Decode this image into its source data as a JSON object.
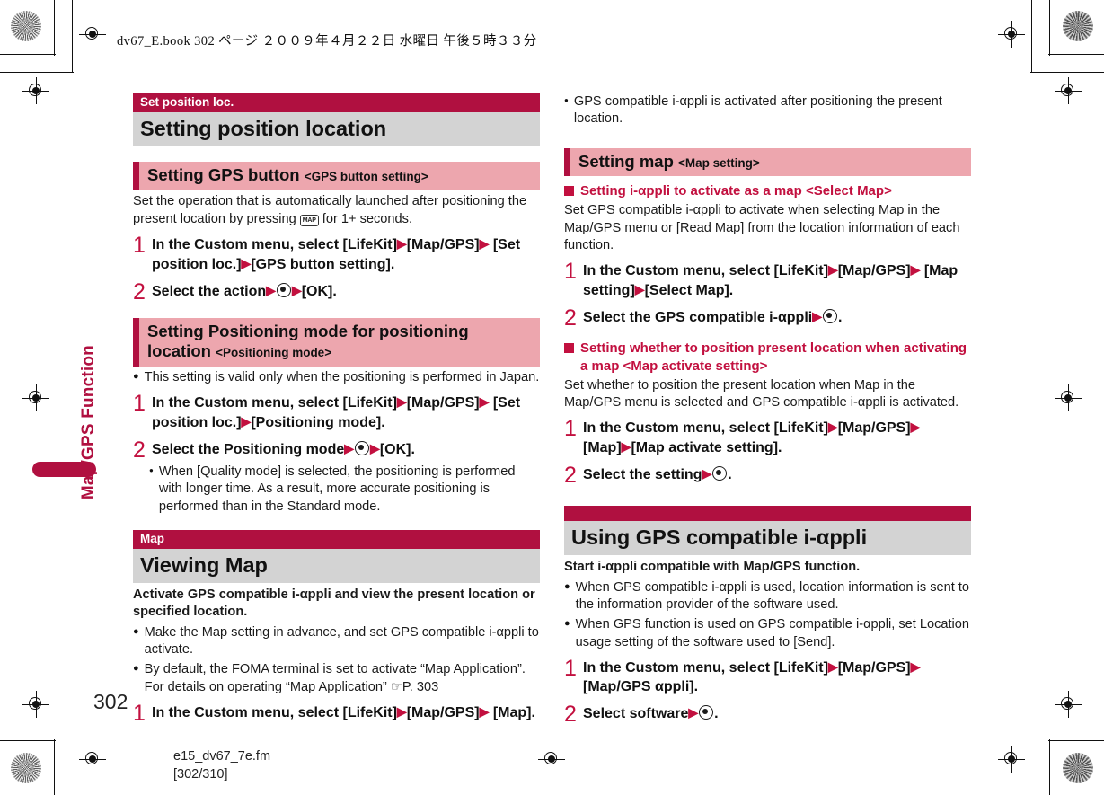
{
  "print_slug": "dv67_E.book   302 ページ   ２００９年４月２２日   水曜日   午後５時３３分",
  "thumb_tab": {
    "label": "Map/GPS Function"
  },
  "footer": {
    "page_number": "302",
    "filename": "e15_dv67_7e.fm",
    "page_range": "[302/310]"
  },
  "colors": {
    "crimson": "#B01040",
    "accent_red": "#C2103F",
    "pink_band": "#EDA6AE",
    "gray_band": "#D3D3D3"
  },
  "left_column": {
    "section": {
      "eyebrow": "Set position loc.",
      "title": "Setting position location"
    },
    "sub_gps_button": {
      "title": "Setting GPS button",
      "angle": "<GPS button setting>",
      "intro_a": "Set the operation that is automatically launched after positioning the present location by pressing ",
      "intro_key": "MAP",
      "intro_b": " for 1+ seconds.",
      "steps": [
        {
          "num": "1",
          "parts": [
            "In the Custom menu, select [LifeKit]",
            "[Map/GPS]",
            "[Set position loc.]",
            "[GPS button setting]."
          ]
        },
        {
          "num": "2",
          "lead": "Select the action",
          "tail": "[OK]."
        }
      ]
    },
    "sub_positioning_mode": {
      "title": "Setting Positioning mode for positioning location",
      "angle": "<Positioning mode>",
      "note": "This setting is valid only when the positioning is performed in Japan.",
      "steps": [
        {
          "num": "1",
          "parts": [
            "In the Custom menu, select [LifeKit]",
            "[Map/GPS]",
            "[Set position loc.]",
            "[Positioning mode]."
          ]
        },
        {
          "num": "2",
          "lead": "Select the Positioning mode",
          "tail": "[OK].",
          "subnote": "When [Quality mode] is selected, the positioning is performed with longer time. As a result, more accurate positioning is performed than in the Standard mode."
        }
      ]
    },
    "section_map": {
      "eyebrow": "Map",
      "title": "Viewing Map",
      "lead": "Activate GPS compatible i-αppli and view the present location or specified location.",
      "bullets": [
        "Make the Map setting in advance, and set GPS compatible i-αppli to activate.",
        "By default, the FOMA terminal is set to activate “Map Application”. For details on operating “Map Application” ☞P. 303"
      ],
      "steps": [
        {
          "num": "1",
          "parts": [
            "In the Custom menu, select [LifeKit]",
            "[Map/GPS]",
            "[Map]."
          ]
        }
      ]
    }
  },
  "right_column": {
    "top_bullet": "GPS compatible i-αppli is activated after positioning the present location.",
    "sub_setting_map": {
      "title": "Setting map",
      "angle": "<Map setting>"
    },
    "select_map": {
      "heading": "Setting i-αppli to activate as a map <Select Map>",
      "intro": "Set GPS compatible i-αppli to activate when selecting Map in the Map/GPS menu or [Read Map] from the location information of each function.",
      "steps": [
        {
          "num": "1",
          "parts": [
            "In the Custom menu, select [LifeKit]",
            "[Map/GPS]",
            "[Map setting]",
            "[Select Map]."
          ]
        },
        {
          "num": "2",
          "lead": "Select the GPS compatible i-αppli",
          "tail": "."
        }
      ]
    },
    "map_activate": {
      "heading": "Setting whether to position present location when activating a map <Map activate setting>",
      "intro": "Set whether to position the present location when Map in the Map/GPS menu is selected and GPS compatible i-αppli is activated.",
      "steps": [
        {
          "num": "1",
          "parts": [
            "In the Custom menu, select [LifeKit]",
            "[Map/GPS]",
            "[Map]",
            "[Map activate setting]."
          ]
        },
        {
          "num": "2",
          "lead": "Select the setting",
          "tail": "."
        }
      ]
    },
    "section_using": {
      "eyebrow": "",
      "title": "Using GPS compatible i-αppli",
      "lead": "Start i-αppli compatible with Map/GPS function.",
      "bullets": [
        "When GPS compatible i-αppli is used, location information is sent to the information provider of the software used.",
        "When GPS function is used on GPS compatible i-αppli, set Location usage setting of the software used to [Send]."
      ],
      "steps": [
        {
          "num": "1",
          "parts": [
            "In the Custom menu, select [LifeKit]",
            "[Map/GPS]",
            "[Map/GPS αppli]."
          ]
        },
        {
          "num": "2",
          "lead": "Select software",
          "tail": "."
        }
      ]
    }
  }
}
